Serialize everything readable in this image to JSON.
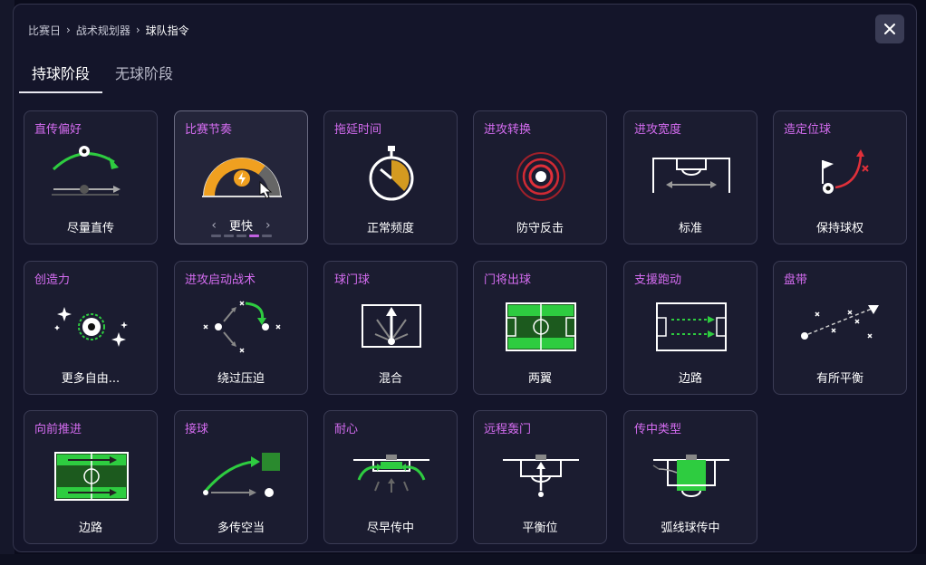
{
  "breadcrumb": {
    "items": [
      "比赛日",
      "战术规划器"
    ],
    "current": "球队指令"
  },
  "tabs": [
    {
      "label": "持球阶段",
      "active": true
    },
    {
      "label": "无球阶段",
      "active": false
    }
  ],
  "colors": {
    "accent_title": "#d46cf0",
    "green": "#2ecc40",
    "orange": "#f0a020",
    "red": "#e0303a"
  },
  "cards": [
    {
      "title": "直传偏好",
      "value": "尽量直传",
      "icon": "pass-direct-icon"
    },
    {
      "title": "比赛节奏",
      "value": "更快",
      "icon": "tempo-gauge-icon",
      "stepper": {
        "prev": "‹",
        "next": "›",
        "steps": 5,
        "selected_index": 3
      }
    },
    {
      "title": "拖延时间",
      "value": "正常频度",
      "icon": "stopwatch-icon"
    },
    {
      "title": "进攻转换",
      "value": "防守反击",
      "icon": "transition-target-icon"
    },
    {
      "title": "进攻宽度",
      "value": "标准",
      "icon": "width-pitch-icon"
    },
    {
      "title": "造定位球",
      "value": "保持球权",
      "icon": "set-piece-icon"
    },
    {
      "title": "创造力",
      "value": "更多自由...",
      "icon": "creative-ball-icon"
    },
    {
      "title": "进攻启动战术",
      "value": "绕过压迫",
      "icon": "build-up-icon"
    },
    {
      "title": "球门球",
      "value": "混合",
      "icon": "goal-kick-icon"
    },
    {
      "title": "门将出球",
      "value": "两翼",
      "icon": "keeper-distribution-icon"
    },
    {
      "title": "支援跑动",
      "value": "边路",
      "icon": "support-runs-icon"
    },
    {
      "title": "盘带",
      "value": "有所平衡",
      "icon": "dribbling-icon"
    },
    {
      "title": "向前推进",
      "value": "边路",
      "icon": "progress-pitch-icon"
    },
    {
      "title": "接球",
      "value": "多传空当",
      "icon": "receive-pass-icon"
    },
    {
      "title": "耐心",
      "value": "尽早传中",
      "icon": "patience-box-icon"
    },
    {
      "title": "远程轰门",
      "value": "平衡位",
      "icon": "long-shot-icon"
    },
    {
      "title": "传中类型",
      "value": "弧线球传中",
      "icon": "cross-type-icon"
    }
  ]
}
